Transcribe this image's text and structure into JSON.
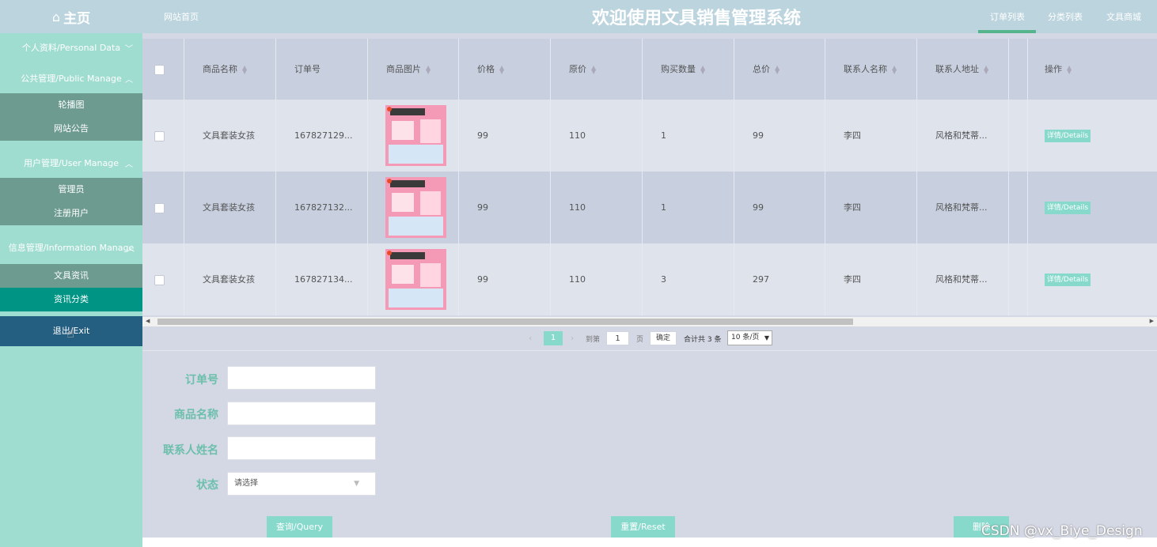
{
  "header": {
    "home_label": "主页",
    "site_home": "网站首页",
    "system_title": "欢迎使用文具销售管理系统",
    "nav_tabs": [
      "订单列表",
      "分类列表",
      "文具商城"
    ]
  },
  "sidebar": {
    "personal": "个人资料/Personal Data",
    "public_manage": "公共管理/Public Manage",
    "public_items": [
      "轮播图",
      "网站公告"
    ],
    "user_manage": "用户管理/User Manage",
    "user_items": [
      "管理员",
      "注册用户"
    ],
    "info_manage": "信息管理/Information Manage",
    "info_items": [
      "文具资讯",
      "资讯分类"
    ],
    "exit": "退出/Exit"
  },
  "table": {
    "columns": [
      "商品名称",
      "订单号",
      "商品图片",
      "价格",
      "原价",
      "购买数量",
      "总价",
      "联系人名称",
      "联系人地址",
      "操作"
    ],
    "rows": [
      {
        "name": "文具套装女孩",
        "order_no": "167827129...",
        "price": "99",
        "original": "110",
        "qty": "1",
        "total": "99",
        "contact": "李四",
        "address": "风格和梵蒂...",
        "action": "详情/Details"
      },
      {
        "name": "文具套装女孩",
        "order_no": "167827132...",
        "price": "99",
        "original": "110",
        "qty": "1",
        "total": "99",
        "contact": "李四",
        "address": "风格和梵蒂...",
        "action": "详情/Details"
      },
      {
        "name": "文具套装女孩",
        "order_no": "167827134...",
        "price": "99",
        "original": "110",
        "qty": "3",
        "total": "297",
        "contact": "李四",
        "address": "风格和梵蒂...",
        "action": "详情/Details"
      }
    ]
  },
  "pager": {
    "current": "1",
    "goto_label": "到第",
    "goto_value": "1",
    "page_unit": "页",
    "confirm": "确定",
    "total": "合计共 3 条",
    "page_size": "10 条/页"
  },
  "form": {
    "order_no_label": "订单号",
    "product_label": "商品名称",
    "contact_label": "联系人姓名",
    "status_label": "状态",
    "status_placeholder": "请选择",
    "query": "查询/Query",
    "reset": "重置/Reset",
    "delete": "删除"
  },
  "watermark": "CSDN @vx_Biye_Design"
}
